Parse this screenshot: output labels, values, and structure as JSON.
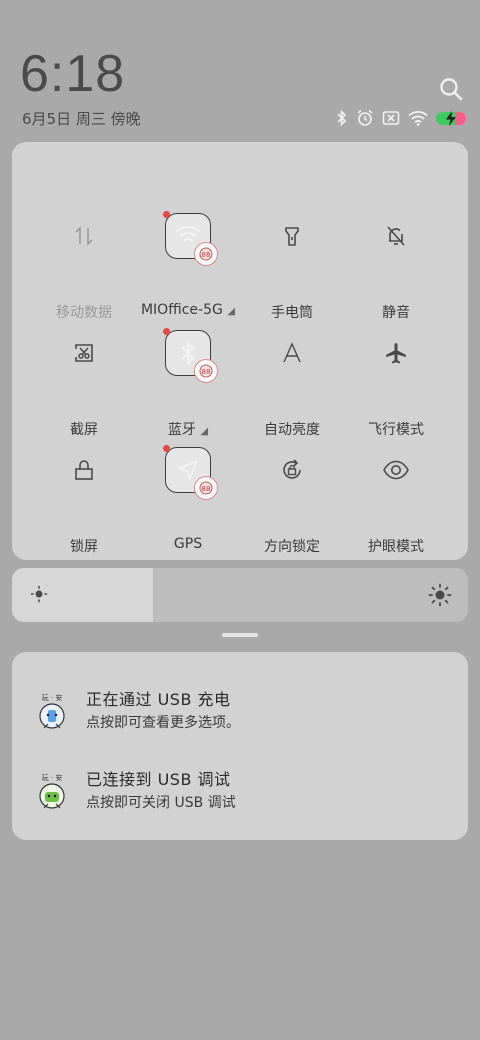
{
  "status": {
    "time": "6:18",
    "date": "6月5日 周三 傍晚"
  },
  "quick_settings": {
    "tiles": [
      {
        "id": "mobile-data",
        "label": "移动数据",
        "icon": "mobile-data-icon",
        "active": false
      },
      {
        "id": "wifi",
        "label": "MIOffice-5G",
        "icon": "wifi-icon",
        "active": true
      },
      {
        "id": "flashlight",
        "label": "手电筒",
        "icon": "flashlight-icon",
        "active": false
      },
      {
        "id": "silent",
        "label": "静音",
        "icon": "bell-off-icon",
        "active": false
      },
      {
        "id": "screenshot",
        "label": "截屏",
        "icon": "screenshot-icon",
        "active": false
      },
      {
        "id": "bluetooth",
        "label": "蓝牙",
        "icon": "bluetooth-icon",
        "active": true
      },
      {
        "id": "auto-brightness",
        "label": "自动亮度",
        "icon": "auto-brightness-icon",
        "active": false
      },
      {
        "id": "airplane",
        "label": "飞行模式",
        "icon": "airplane-icon",
        "active": false
      },
      {
        "id": "lock-screen",
        "label": "锁屏",
        "icon": "lock-icon",
        "active": false
      },
      {
        "id": "gps",
        "label": "GPS",
        "icon": "location-arrow-icon",
        "active": true
      },
      {
        "id": "rotation-lock",
        "label": "方向锁定",
        "icon": "rotation-lock-icon",
        "active": false
      },
      {
        "id": "eye-care",
        "label": "护眼模式",
        "icon": "eye-icon",
        "active": false
      }
    ],
    "page_count": 2,
    "current_page": 1
  },
  "brightness": {
    "level_fraction": 0.31
  },
  "notifications": [
    {
      "title": "正在通过 USB 充电",
      "desc": "点按即可查看更多选项。",
      "icon": "usb-charging-mascot-icon"
    },
    {
      "title": "已连接到 USB 调试",
      "desc": "点按即可关闭 USB 调试",
      "icon": "usb-debug-mascot-icon"
    }
  ],
  "colors": {
    "background": "#a9a9a9",
    "panel": "#d2d2d2",
    "battery_charged": "#3ecb5d",
    "battery_low": "#ff5a8a",
    "badge_dot": "#e24a4a"
  }
}
